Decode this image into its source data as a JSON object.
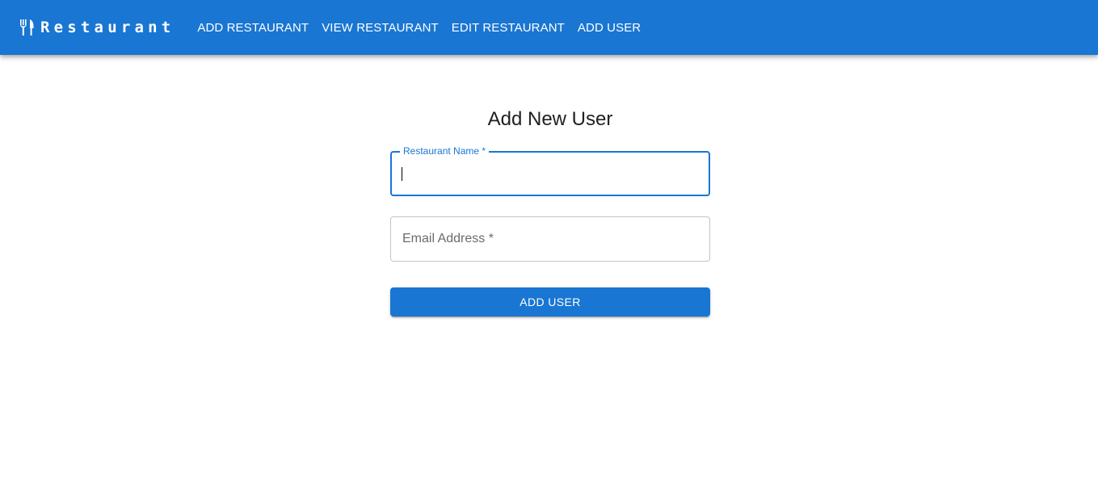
{
  "header": {
    "brand_icon": "restaurant-icon",
    "brand_text": "Restaurant",
    "nav": [
      {
        "label": "ADD RESTAURANT"
      },
      {
        "label": "VIEW RESTAURANT"
      },
      {
        "label": "EDIT RESTAURANT"
      },
      {
        "label": "ADD USER"
      }
    ]
  },
  "form": {
    "title": "Add New User",
    "restaurant_name": {
      "label": "Restaurant Name *",
      "value": "",
      "focused": true
    },
    "email": {
      "label": "Email Address *",
      "value": ""
    },
    "submit_label": "ADD USER"
  },
  "colors": {
    "primary": "#1976d2",
    "background": "#ffffff",
    "text": "#212121",
    "muted": "#6b6b6b"
  }
}
